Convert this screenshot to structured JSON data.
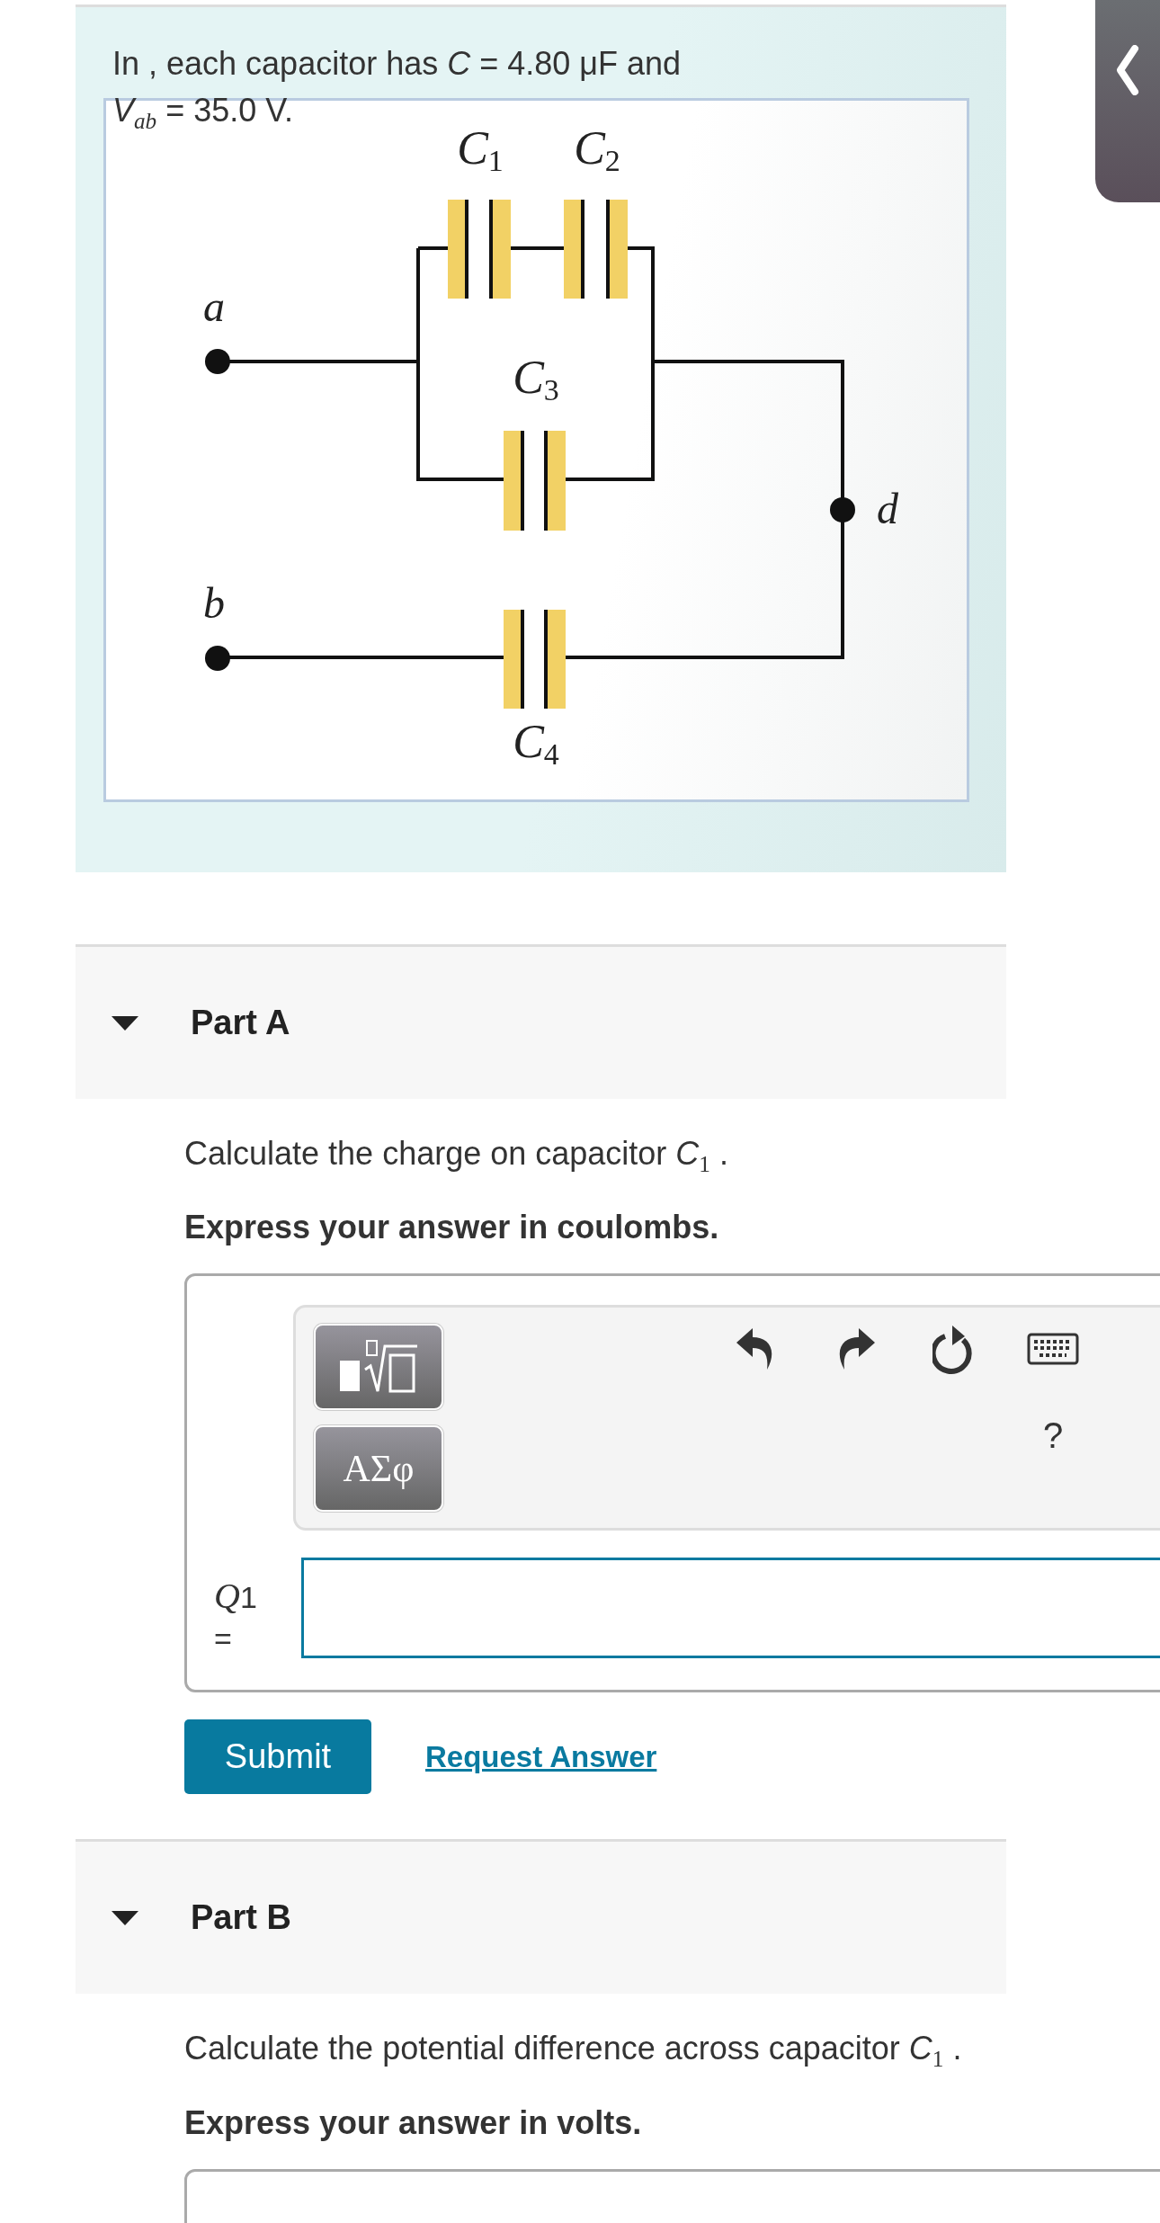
{
  "side_tab": {
    "expanded": false
  },
  "problem": {
    "lines": [
      "In , each capacitor has *C* = 4.80 μF and",
      "*V*$_{ab}$ = 35.0 V."
    ],
    "figure": {
      "capacitors": [
        {
          "letter": "C",
          "index": "1"
        },
        {
          "letter": "C",
          "index": "2"
        },
        {
          "letter": "C",
          "index": "3"
        },
        {
          "letter": "C",
          "index": "4"
        }
      ],
      "nodes": [
        "a",
        "b",
        "d"
      ]
    }
  },
  "parts": [
    {
      "title": "Part A",
      "expanded": true,
      "question": "Calculate the charge on capacitor *C*$_{1}$ .",
      "instruction": "Express your answer in coulombs.",
      "answer": {
        "symbols_button": "ΑΣφ",
        "help": "?",
        "label": {
          "symbol": "Q",
          "index": "1",
          "relation": "="
        }
      },
      "submit": "Submit",
      "request": "Request Answer"
    },
    {
      "title": "Part B",
      "expanded": true,
      "question": "Calculate the potential difference across capacitor *C*$_{1}$ .",
      "instruction": "Express your answer in volts."
    }
  ]
}
